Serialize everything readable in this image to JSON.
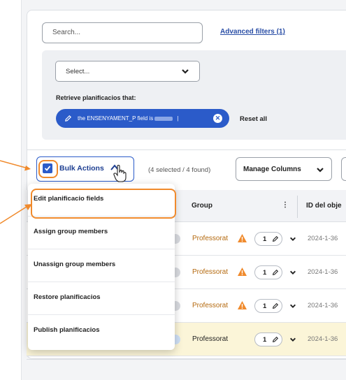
{
  "search": {
    "placeholder": "Search..."
  },
  "filters": {
    "advanced_link": "Advanced filters (1)",
    "select_value": "Select...",
    "retrieve_label": "Retrieve planificacios that:",
    "chip_text": "the ENSENYAMENT_P field is",
    "chip_separator": "|",
    "chip_close": "✕",
    "reset_label": "Reset all"
  },
  "toolbar": {
    "bulk_actions_label": "Bulk Actions",
    "counts_text": "(4 selected / 4 found)",
    "manage_columns_label": "Manage Columns"
  },
  "table": {
    "headers": {
      "group": "Group",
      "menu": "⋮",
      "id": "ID del obje"
    },
    "rows": [
      {
        "group": "Professorat",
        "warning": true,
        "count": "1",
        "date": "2024-1-36",
        "selected": false
      },
      {
        "group": "Professorat",
        "warning": true,
        "count": "1",
        "date": "2024-1-36",
        "selected": false
      },
      {
        "group": "Professorat",
        "warning": true,
        "count": "1",
        "date": "2024-1-36",
        "selected": false
      },
      {
        "group": "Professorat",
        "warning": false,
        "count": "1",
        "date": "2024-1-36",
        "selected": true
      }
    ]
  },
  "bulk_menu": {
    "items": [
      "Edit planificacio fields",
      "Assign group members",
      "Unassign group members",
      "Restore planificacios",
      "Publish planificacios"
    ]
  },
  "colors": {
    "accent": "#2b5bc9",
    "highlight": "#f08a2c",
    "warning": "#f08a2c"
  },
  "icons": [
    "chevron-down-icon",
    "pencil-icon",
    "close-icon",
    "checkbox-checked-icon",
    "caret-up-icon",
    "hand-cursor-icon",
    "warning-icon",
    "kebab-menu-icon"
  ]
}
